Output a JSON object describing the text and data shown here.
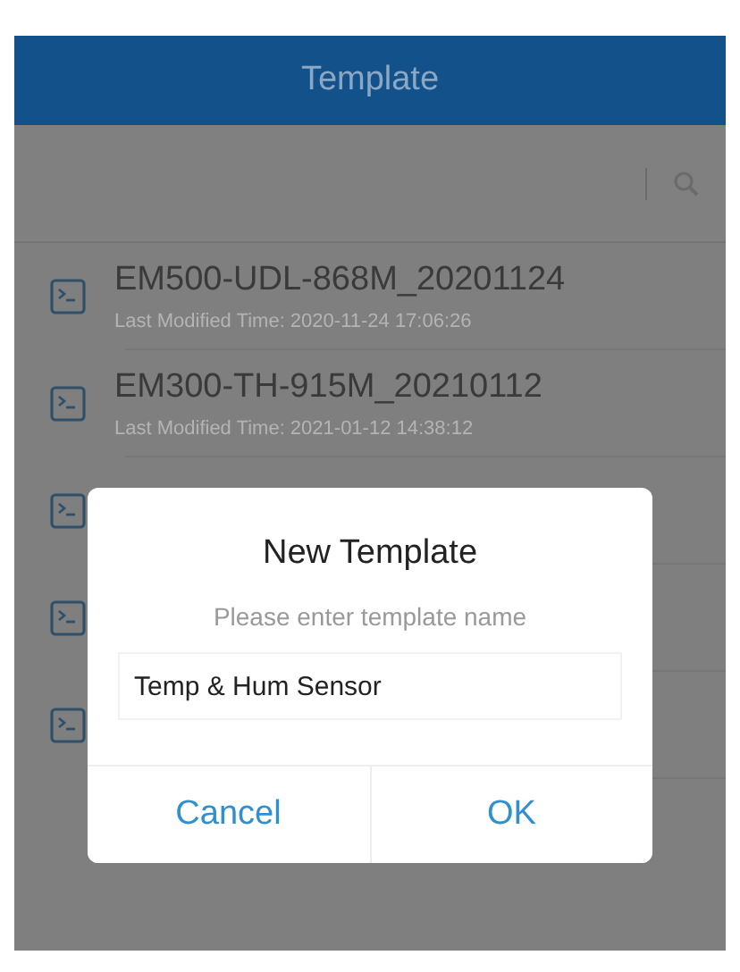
{
  "header": {
    "title": "Template"
  },
  "rows": [
    {
      "kind": "full",
      "title": "EM500-UDL-868M_20201124",
      "subtitle": "Last Modified Time: 2020-11-24 17:06:26"
    },
    {
      "kind": "full",
      "title": "EM300-TH-915M_20210112",
      "subtitle": "Last Modified Time: 2021-01-12 14:38:12"
    },
    {
      "kind": "covered"
    },
    {
      "kind": "covered"
    },
    {
      "kind": "covered"
    }
  ],
  "dialog": {
    "title": "New Template",
    "hint": "Please enter template name",
    "value": "Temp & Hum Sensor",
    "buttons": [
      "Cancel",
      "OK"
    ]
  }
}
